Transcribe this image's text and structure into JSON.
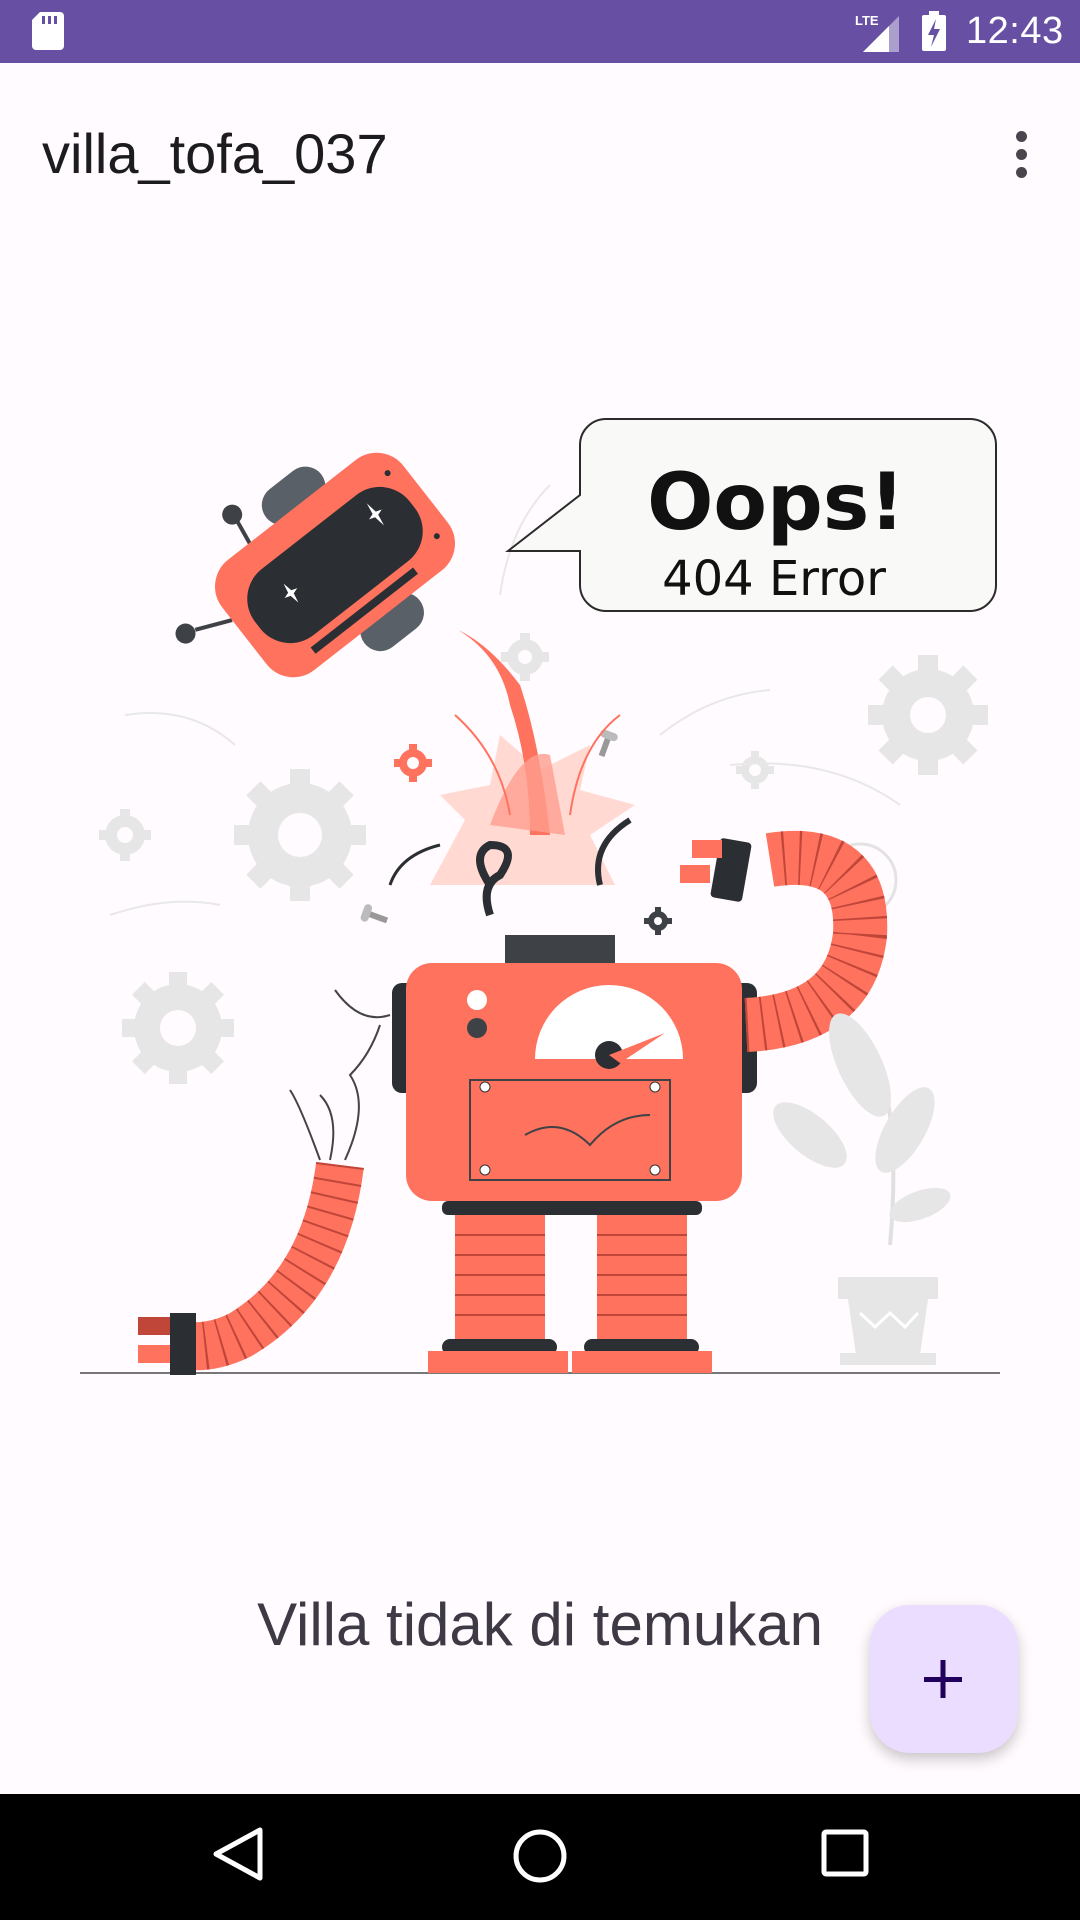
{
  "status_bar": {
    "time": "12:43",
    "network": "LTE",
    "color": "#6750a4"
  },
  "app_bar": {
    "title": "villa_tofa_037",
    "menu_icon": "more-vert-icon"
  },
  "illustration": {
    "bubble_title": "Oops!",
    "bubble_subtitle": "404 Error",
    "accent": "#ff725e"
  },
  "empty_state": {
    "message": "Villa tidak di temukan"
  },
  "fab": {
    "icon": "plus-icon",
    "color": "#eaddff"
  },
  "nav_bar": {
    "back_icon": "back-icon",
    "home_icon": "home-icon",
    "recents_icon": "recents-icon"
  }
}
